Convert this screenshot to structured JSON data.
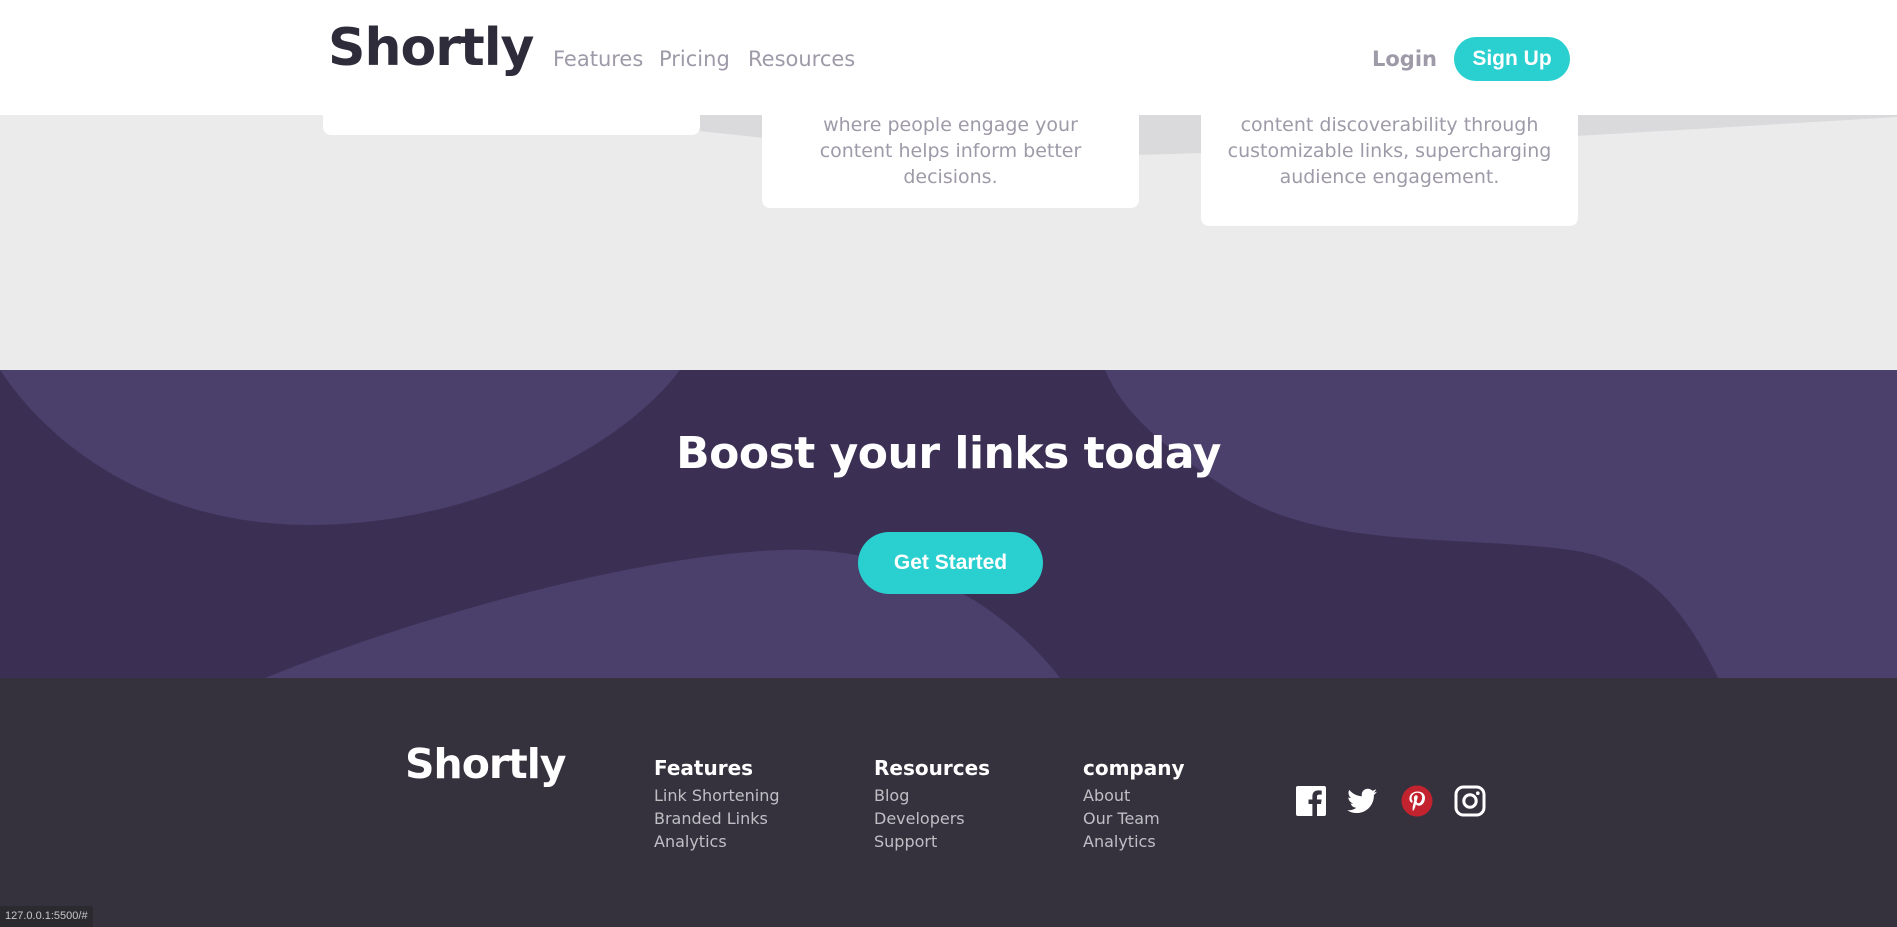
{
  "header": {
    "logo": "Shortly",
    "nav": [
      "Features",
      "Pricing",
      "Resources"
    ],
    "login": "Login",
    "signup": "Sign Up"
  },
  "stats": {
    "card_middle_lines": [
      "where people engage your",
      "content helps inform better",
      "decisions."
    ],
    "card_right_lines": [
      "content discoverability through",
      "customizable links, supercharging",
      "audience engagement."
    ]
  },
  "boost": {
    "title": "Boost your links today",
    "button": "Get Started"
  },
  "footer": {
    "logo": "Shortly",
    "columns": [
      {
        "title": "Features",
        "links": [
          "Link Shortening",
          "Branded Links",
          "Analytics"
        ]
      },
      {
        "title": "Resources",
        "links": [
          "Blog",
          "Developers",
          "Support"
        ]
      },
      {
        "title": "company",
        "links": [
          "About",
          "Our Team",
          "Analytics"
        ]
      }
    ],
    "social": [
      "facebook-icon",
      "twitter-icon",
      "pinterest-icon",
      "instagram-icon"
    ]
  },
  "status_bar": {
    "url": "127.0.0.1:5500/#"
  },
  "colors": {
    "accent": "#2acfcf",
    "dark_violet": "#3b2f54",
    "footer_bg": "#35323e",
    "pinterest_red": "#c3232e"
  }
}
